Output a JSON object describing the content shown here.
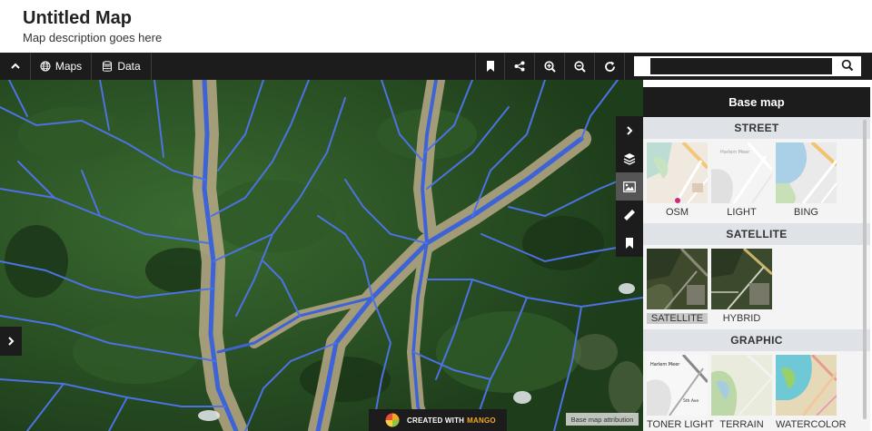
{
  "header": {
    "title": "Untitled Map",
    "description": "Map description goes here"
  },
  "toolbar": {
    "maps_label": "Maps",
    "data_label": "Data",
    "search_value": "",
    "search_placeholder": ""
  },
  "map": {
    "credit_prefix": "CREATED WITH",
    "credit_brand": "MANGO",
    "attribution": "Base map attribution"
  },
  "panel": {
    "title": "Base map",
    "sections": [
      {
        "title": "STREET",
        "tiles": [
          {
            "label": "OSM"
          },
          {
            "label": "LIGHT"
          },
          {
            "label": "BING"
          }
        ]
      },
      {
        "title": "SATELLITE",
        "tiles": [
          {
            "label": "SATELLITE",
            "selected": true
          },
          {
            "label": "HYBRID"
          }
        ]
      },
      {
        "title": "GRAPHIC",
        "tiles": [
          {
            "label": "TONER LIGHT"
          },
          {
            "label": "TERRAIN"
          },
          {
            "label": "WATERCOLOR"
          }
        ]
      }
    ]
  },
  "icons": {
    "toolbar": [
      "chevron-up-icon",
      "globe-icon",
      "database-icon",
      "bookmark-icon",
      "share-icon",
      "zoom-in-icon",
      "zoom-out-icon",
      "refresh-icon",
      "search-icon"
    ],
    "tools": [
      "chevron-right-icon",
      "layers-icon",
      "image-icon",
      "ruler-icon",
      "bookmark-icon"
    ]
  },
  "colors": {
    "toolbar_bg": "#1c1c1c",
    "river_blue": "#3d63d6",
    "forest_green": "#24461f",
    "brand_orange": "#f5a623"
  }
}
